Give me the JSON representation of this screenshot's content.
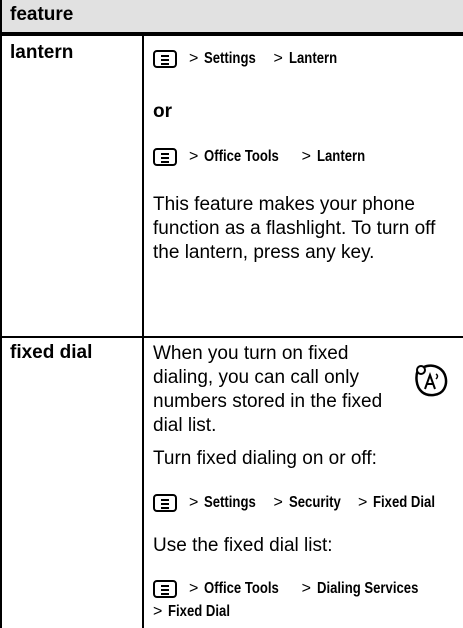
{
  "header": {
    "title": "feature"
  },
  "rows": {
    "lantern": {
      "term": "lantern",
      "path1": {
        "s1": "Settings",
        "s2": "Lantern"
      },
      "or": "or",
      "path2": {
        "s1": "Office Tools",
        "s2": "Lantern"
      },
      "description": "This feature makes your phone function as a flashlight. To turn off the lantern, press any key."
    },
    "fixed_dial": {
      "term": "fixed dial",
      "intro": "When you turn on fixed dialing, you can call only numbers stored in the fixed dial list.",
      "turn_label": "Turn fixed dialing on or off:",
      "path3": {
        "s1": "Settings",
        "s2": "Security",
        "s3": "Fixed Dial"
      },
      "use_label": "Use the fixed dial list:",
      "path4": {
        "s1": "Office Tools",
        "s2": "Dialing Services",
        "s3": "Fixed Dial"
      }
    }
  },
  "separator": ">",
  "icons": {
    "menu_key": "menu-key-icon",
    "network_feature": "network-dial-icon"
  }
}
